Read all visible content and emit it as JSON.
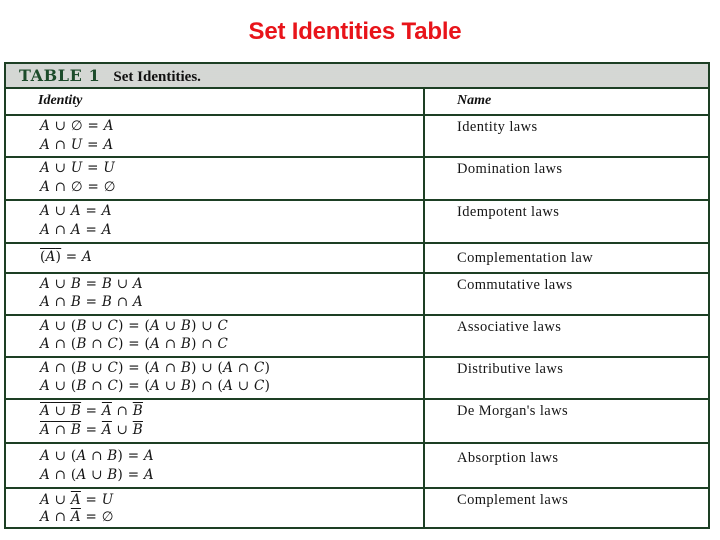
{
  "slide": {
    "title": "Set Identities Table",
    "title_color": "#e8141a"
  },
  "table": {
    "caption_number": "TABLE 1",
    "caption_text": "Set Identities.",
    "header": {
      "identity": "Identity",
      "name": "Name"
    },
    "border_color": "#1d3f24",
    "rows": [
      {
        "identities": [
          "A ∪ ∅ = A",
          "A ∩ U = A"
        ],
        "name": "Identity laws"
      },
      {
        "identities": [
          "A ∪ U = U",
          "A ∩ ∅ = ∅"
        ],
        "name": "Domination laws"
      },
      {
        "identities": [
          "A ∪ A = A",
          "A ∩ A = A"
        ],
        "name": "Idempotent laws"
      },
      {
        "identities": [
          "(A̅) = A"
        ],
        "name": "Complementation law"
      },
      {
        "identities": [
          "A ∪ B = B ∪ A",
          "A ∩ B = B ∩ A"
        ],
        "name": "Commutative laws"
      },
      {
        "identities": [
          "A ∪ (B ∪ C) = (A ∪ B) ∪ C",
          "A ∩ (B ∩ C) = (A ∩ B) ∩ C"
        ],
        "name": "Associative laws"
      },
      {
        "identities": [
          "A ∩ (B ∪ C) = (A ∩ B) ∪ (A ∩ C)",
          "A ∪ (B ∩ C) = (A ∪ B) ∩ (A ∪ C)"
        ],
        "name": "Distributive laws"
      },
      {
        "identities": [
          "A ∪ B (complement) = A̅ ∩ B̅",
          "A ∩ B (complement) = A̅ ∪ B̅"
        ],
        "name": "De Morgan's laws"
      },
      {
        "identities": [
          "A ∪ (A ∩ B) = A",
          "A ∩ (A ∪ B) = A"
        ],
        "name": "Absorption laws"
      },
      {
        "identities": [
          "A ∪ A̅ = U",
          "A ∩ A̅ = ∅"
        ],
        "name": "Complement laws"
      }
    ]
  }
}
